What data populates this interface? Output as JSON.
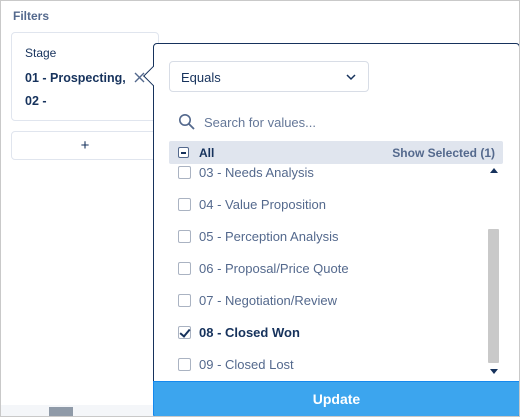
{
  "filters_title": "Filters",
  "filter_card": {
    "field": "Stage",
    "value_line1": "01 - Prospecting,",
    "value_line2": "02 -",
    "remove_icon": "close-icon"
  },
  "add_filter_label": "+",
  "popover": {
    "operator": "Equals",
    "search_placeholder": "Search for values...",
    "all_label": "All",
    "show_selected": "Show Selected (1)",
    "items": [
      {
        "label": "03 - Needs Analysis",
        "checked": false
      },
      {
        "label": "04 - Value Proposition",
        "checked": false
      },
      {
        "label": "05 - Perception Analysis",
        "checked": false
      },
      {
        "label": "06 - Proposal/Price Quote",
        "checked": false
      },
      {
        "label": "07 - Negotiation/Review",
        "checked": false
      },
      {
        "label": "08 - Closed Won",
        "checked": true
      },
      {
        "label": "09 - Closed Lost",
        "checked": false
      }
    ],
    "update_label": "Update"
  },
  "colors": {
    "accent": "#3ca5ee",
    "text_primary": "#16325c",
    "text_secondary": "#54698d"
  }
}
